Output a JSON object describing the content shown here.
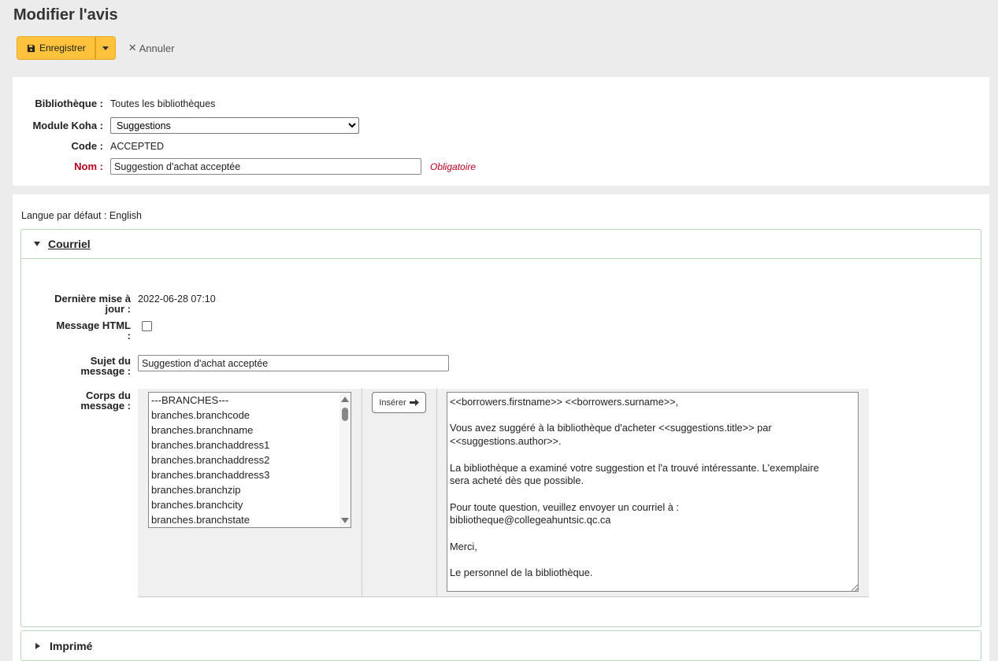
{
  "page": {
    "title": "Modifier l'avis"
  },
  "toolbar": {
    "save_label": "Enregistrer",
    "cancel_label": "Annuler"
  },
  "notice": {
    "library_label": "Bibliothèque :",
    "library_value": "Toutes les bibliothèques",
    "module_label": "Module Koha :",
    "module_value": "Suggestions",
    "code_label": "Code :",
    "code_value": "ACCEPTED",
    "name_label": "Nom :",
    "name_value": "Suggestion d'achat acceptée",
    "required_hint": "Obligatoire"
  },
  "language": {
    "default_label": "Langue par défaut :",
    "default_value": "English"
  },
  "email": {
    "section_title": "Courriel",
    "updated_label_1": "Dernière mise à",
    "updated_label_2": "jour :",
    "updated_value": "2022-06-28 07:10",
    "html_label_1": "Message HTML",
    "html_label_2": ":",
    "html_checked": false,
    "subject_label_1": "Sujet du",
    "subject_label_2": "message :",
    "subject_value": "Suggestion d'achat acceptée",
    "body_label_1": "Corps du",
    "body_label_2": "message :",
    "fields": [
      "---BRANCHES---",
      "branches.branchcode",
      "branches.branchname",
      "branches.branchaddress1",
      "branches.branchaddress2",
      "branches.branchaddress3",
      "branches.branchzip",
      "branches.branchcity",
      "branches.branchstate"
    ],
    "insert_label": "Insérer",
    "body_value": "<<borrowers.firstname>> <<borrowers.surname>>,\n\nVous avez suggéré à la bibliothèque d'acheter <<suggestions.title>> par\n<<suggestions.author>>.\n\nLa bibliothèque a examiné votre suggestion et l'a trouvé intéressante. L'exemplaire\nsera acheté dès que possible.\n\nPour toute question, veuillez envoyer un courriel à :\nbibliotheque@collegeahuntsic.qc.ca\n\nMerci,\n\nLe personnel de la bibliothèque."
  },
  "print": {
    "section_title": "Imprimé"
  }
}
